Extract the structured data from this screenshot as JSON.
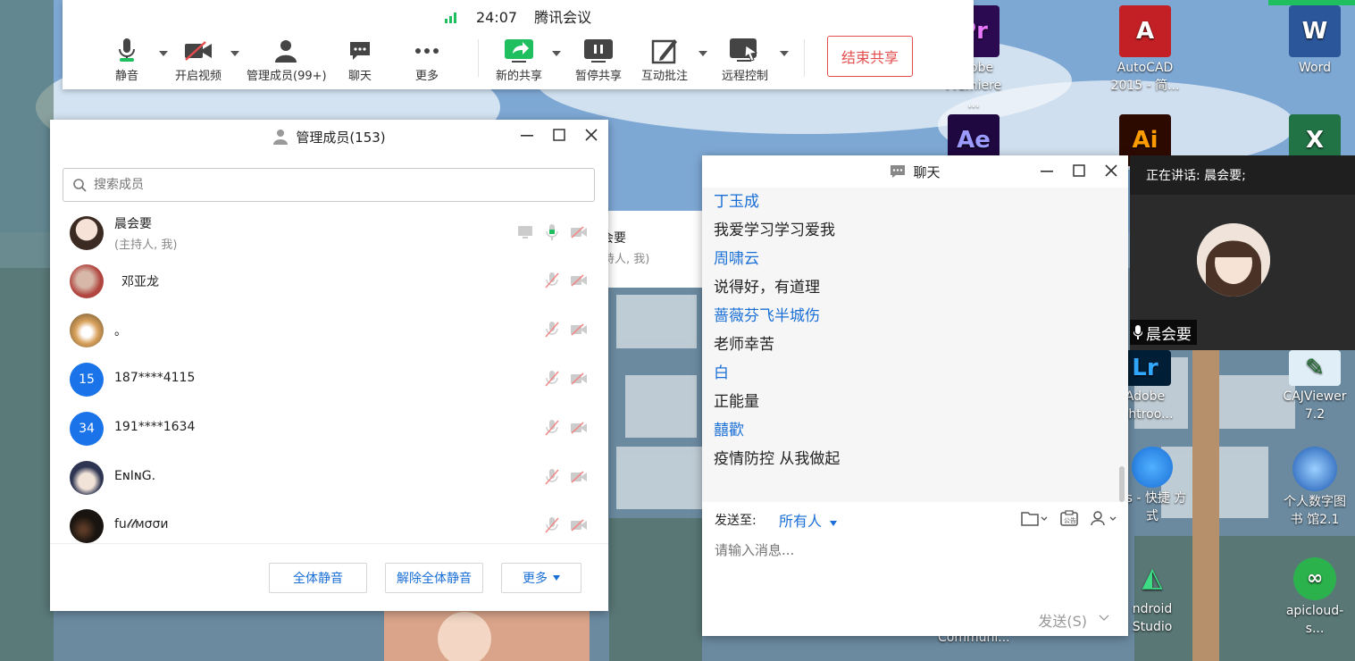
{
  "desktop": {
    "icons": [
      {
        "label": "Adobe Premiere ...",
        "short": "Pr",
        "color": "#2c0a52",
        "accent": "#ea77ff",
        "name": "premiere-desktop-icon"
      },
      {
        "label": "AutoCAD 2015 - 简...",
        "short": "A",
        "color": "#c32026",
        "accent": "#ffffff",
        "name": "autocad-desktop-icon"
      },
      {
        "label": "Word",
        "short": "W",
        "color": "#2b579a",
        "accent": "#ffffff",
        "name": "word-desktop-icon"
      },
      {
        "label": "",
        "short": "Ae",
        "color": "#1f0740",
        "accent": "#9a9aff",
        "name": "after-effects-desktop-icon"
      },
      {
        "label": "",
        "short": "Ai",
        "color": "#2d0a00",
        "accent": "#ff9a00",
        "name": "illustrator-desktop-icon"
      },
      {
        "label": "",
        "short": "X",
        "color": "#217346",
        "accent": "#ffffff",
        "name": "excel-desktop-icon"
      },
      {
        "label": "Adobe ightroo...",
        "short": "Lr",
        "color": "#001e36",
        "accent": "#31a8ff",
        "name": "lightroom-desktop-icon"
      },
      {
        "label": "CAJViewer 7.2",
        "short": "✎",
        "color": "#e0eef8",
        "accent": "#1a6e2a",
        "name": "cajviewer-desktop-icon"
      },
      {
        "label": "ps - 快捷 方式",
        "short": "",
        "color": "transparent",
        "accent": "#ffffff",
        "name": "wps-shortcut-desktop-icon"
      },
      {
        "label": "个人数字图书 馆2.1",
        "short": "",
        "color": "transparent",
        "accent": "#ffffff",
        "name": "digital-library-desktop-icon"
      },
      {
        "label": "ndroid Studio",
        "short": "",
        "color": "transparent",
        "accent": "#ffffff",
        "name": "android-studio-desktop-icon"
      },
      {
        "label": "apicloud-s...",
        "short": "",
        "color": "transparent",
        "accent": "#ffffff",
        "name": "apicloud-desktop-icon"
      },
      {
        "label": "Communi...",
        "short": "",
        "color": "transparent",
        "accent": "#ffffff",
        "name": "communi-desktop-icon"
      }
    ]
  },
  "toolbar": {
    "time": "24:07",
    "app_title": "腾讯会议",
    "buttons": {
      "mute": "静音",
      "video": "开启视频",
      "members": "管理成员(99+)",
      "chat": "聊天",
      "more": "更多",
      "new_share": "新的共享",
      "pause_share": "暂停共享",
      "annotate": "互动批注",
      "remote": "远程控制"
    },
    "end_share": "结束共享",
    "accent": "#1fbf5f",
    "danger": "#e34d4d"
  },
  "members_window": {
    "title": "管理成员(153)",
    "search_placeholder": "搜索成员",
    "members": [
      {
        "name": "晨会要",
        "sub": "(主持人, 我)",
        "avatar": "photo"
      },
      {
        "name": "邓亚龙",
        "sub": "",
        "avatar": "photo"
      },
      {
        "name": "。",
        "sub": "",
        "avatar": "photo"
      },
      {
        "name": "187****4115",
        "sub": "",
        "avatar": "15"
      },
      {
        "name": "191****1634",
        "sub": "",
        "avatar": "34"
      },
      {
        "name": "EɴIɴG.",
        "sub": "",
        "avatar": "photo"
      },
      {
        "name": "fu𝓁𝓁мσσи",
        "sub": "",
        "avatar": "photo"
      }
    ],
    "buttons": {
      "mute_all": "全体静音",
      "unmute_all": "解除全体静音",
      "more": "更多"
    }
  },
  "behind_panel": {
    "name_fragment": "会要",
    "sub_fragment": "持人, 我)"
  },
  "chat_window": {
    "title": "聊天",
    "messages": [
      {
        "sender": "丁玉成",
        "text": "我爱学习学习爱我"
      },
      {
        "sender": "周啸云",
        "text": "说得好，有道理"
      },
      {
        "sender": "蔷薇芬飞半城伤",
        "text": "老师幸苦"
      },
      {
        "sender": "白",
        "text": "正能量"
      },
      {
        "sender": "囍歡",
        "text": "疫情防控 从我做起"
      }
    ],
    "send_to_label": "发送至:",
    "send_to_target": "所有人",
    "input_placeholder": "请输入消息...",
    "send_button": "发送(S)"
  },
  "speaker_panel": {
    "speaking_label": "正在讲话: 晨会要;",
    "speaker_name": "晨会要"
  }
}
